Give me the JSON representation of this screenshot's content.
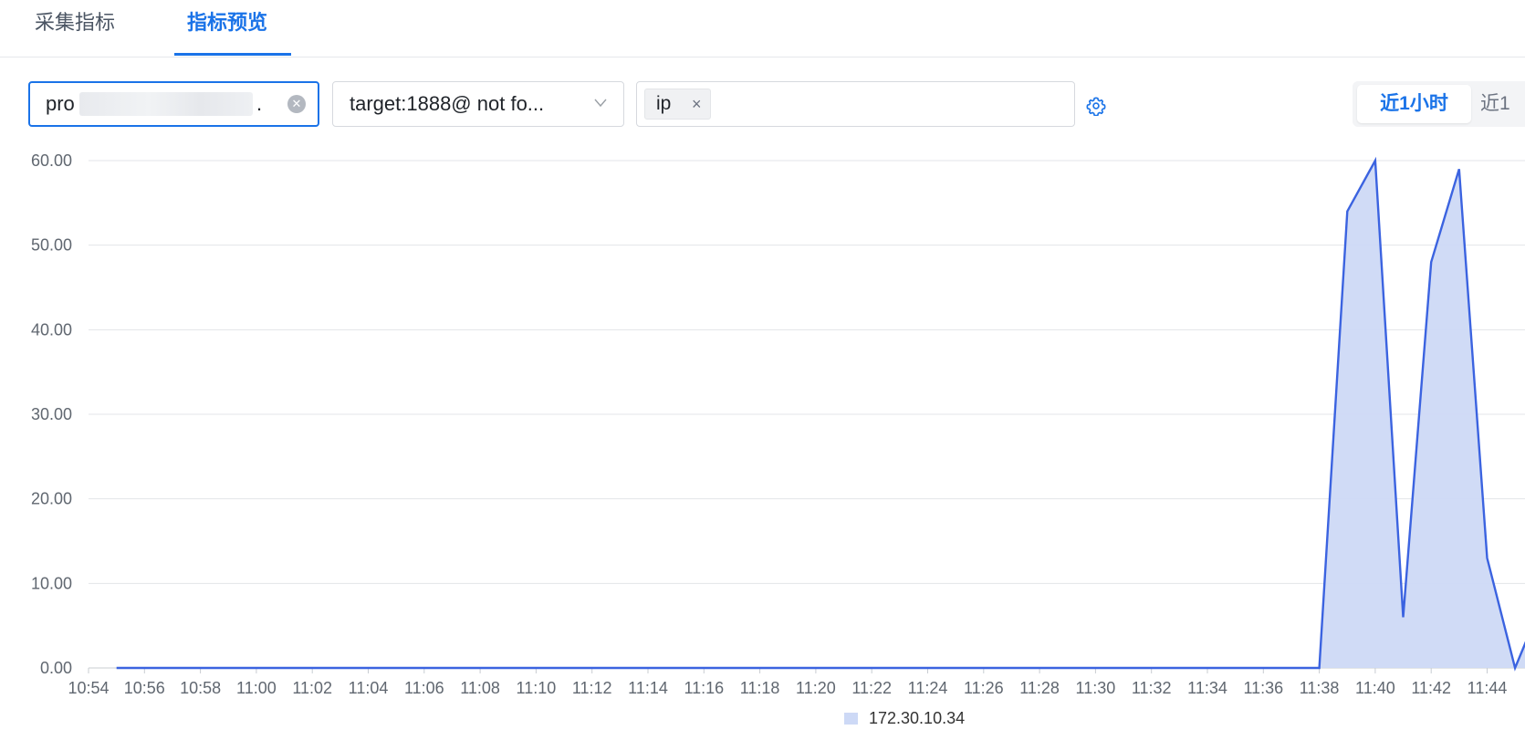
{
  "tabs": [
    {
      "label": "采集指标",
      "active": false
    },
    {
      "label": "指标预览",
      "active": true
    }
  ],
  "toolbar": {
    "metric_value": "pro",
    "metric_suffix": ".",
    "target_value": "target:1888@ not fo...",
    "group_by_tags": [
      "ip"
    ],
    "time_range_options": [
      "近1小时",
      "近1"
    ],
    "time_range_selected": "近1小时"
  },
  "colors": {
    "accent": "#1a73e8",
    "series_line": "#3b63e0",
    "series_fill": "#cdd9f6"
  },
  "icons": {
    "clear": "circle-x-icon",
    "dropdown": "chevron-down-icon",
    "tag_close": "close-icon",
    "settings": "gear-icon"
  },
  "chart_data": {
    "type": "area",
    "title": "",
    "xlabel": "",
    "ylabel": "",
    "ylim": [
      0,
      60
    ],
    "y_ticks": [
      "0.00",
      "10.00",
      "20.00",
      "30.00",
      "40.00",
      "50.00",
      "60.00"
    ],
    "x_ticks": [
      "10:54",
      "10:56",
      "10:58",
      "11:00",
      "11:02",
      "11:04",
      "11:06",
      "11:08",
      "11:10",
      "11:12",
      "11:14",
      "11:16",
      "11:18",
      "11:20",
      "11:22",
      "11:24",
      "11:26",
      "11:28",
      "11:30",
      "11:32",
      "11:34",
      "11:36",
      "11:38",
      "11:40",
      "11:42",
      "11:44"
    ],
    "grid": true,
    "legend_position": "bottom",
    "series": [
      {
        "name": "172.30.10.34",
        "x": [
          "10:55",
          "10:56",
          "10:57",
          "10:58",
          "10:59",
          "11:00",
          "11:01",
          "11:02",
          "11:03",
          "11:04",
          "11:05",
          "11:06",
          "11:07",
          "11:08",
          "11:09",
          "11:10",
          "11:11",
          "11:12",
          "11:13",
          "11:14",
          "11:15",
          "11:16",
          "11:17",
          "11:18",
          "11:19",
          "11:20",
          "11:21",
          "11:22",
          "11:23",
          "11:24",
          "11:25",
          "11:26",
          "11:27",
          "11:28",
          "11:29",
          "11:30",
          "11:31",
          "11:32",
          "11:33",
          "11:34",
          "11:35",
          "11:36",
          "11:37",
          "11:38",
          "11:39",
          "11:40",
          "11:41",
          "11:42",
          "11:43",
          "11:44",
          "11:45",
          "11:46"
        ],
        "y": [
          0,
          0,
          0,
          0,
          0,
          0,
          0,
          0,
          0,
          0,
          0,
          0,
          0,
          0,
          0,
          0,
          0,
          0,
          0,
          0,
          0,
          0,
          0,
          0,
          0,
          0,
          0,
          0,
          0,
          0,
          0,
          0,
          0,
          0,
          0,
          0,
          0,
          0,
          0,
          0,
          0,
          0,
          0,
          0,
          54,
          60,
          6,
          48,
          59,
          13,
          0,
          8
        ]
      }
    ]
  }
}
